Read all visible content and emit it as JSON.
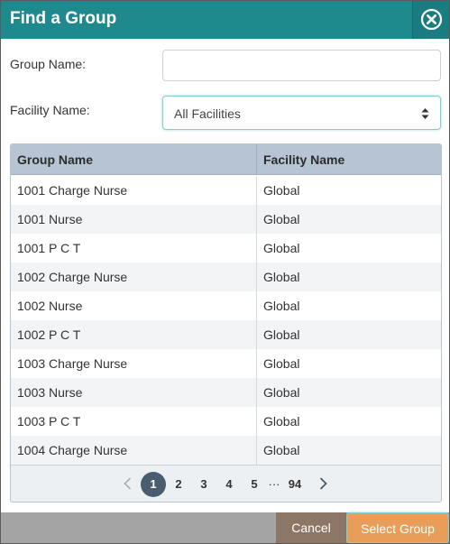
{
  "dialog": {
    "title": "Find a Group",
    "close_icon": "close-circle-icon"
  },
  "form": {
    "group_name_label": "Group Name:",
    "group_name_value": "",
    "facility_name_label": "Facility Name:",
    "facility_selected": "All Facilities"
  },
  "table": {
    "columns": [
      "Group Name",
      "Facility Name"
    ],
    "rows": [
      {
        "group": "1001 Charge Nurse",
        "facility": "Global"
      },
      {
        "group": "1001 Nurse",
        "facility": "Global"
      },
      {
        "group": "1001 P C T",
        "facility": "Global"
      },
      {
        "group": "1002 Charge Nurse",
        "facility": "Global"
      },
      {
        "group": "1002 Nurse",
        "facility": "Global"
      },
      {
        "group": "1002 P C T",
        "facility": "Global"
      },
      {
        "group": "1003 Charge Nurse",
        "facility": "Global"
      },
      {
        "group": "1003 Nurse",
        "facility": "Global"
      },
      {
        "group": "1003 P C T",
        "facility": "Global"
      },
      {
        "group": "1004 Charge Nurse",
        "facility": "Global"
      }
    ]
  },
  "pager": {
    "prev_icon": "chevron-left-icon",
    "next_icon": "chevron-right-icon",
    "pages": [
      "1",
      "2",
      "3",
      "4",
      "5"
    ],
    "current_page": "1",
    "ellipsis": "···",
    "last_page": "94"
  },
  "footer": {
    "cancel_label": "Cancel",
    "select_label": "Select Group"
  },
  "colors": {
    "titlebar": "#1f8a8e",
    "header": "#b6c4d3",
    "active_page": "#4a5c70",
    "cancel": "#8c7767",
    "select": "#e89e58"
  }
}
